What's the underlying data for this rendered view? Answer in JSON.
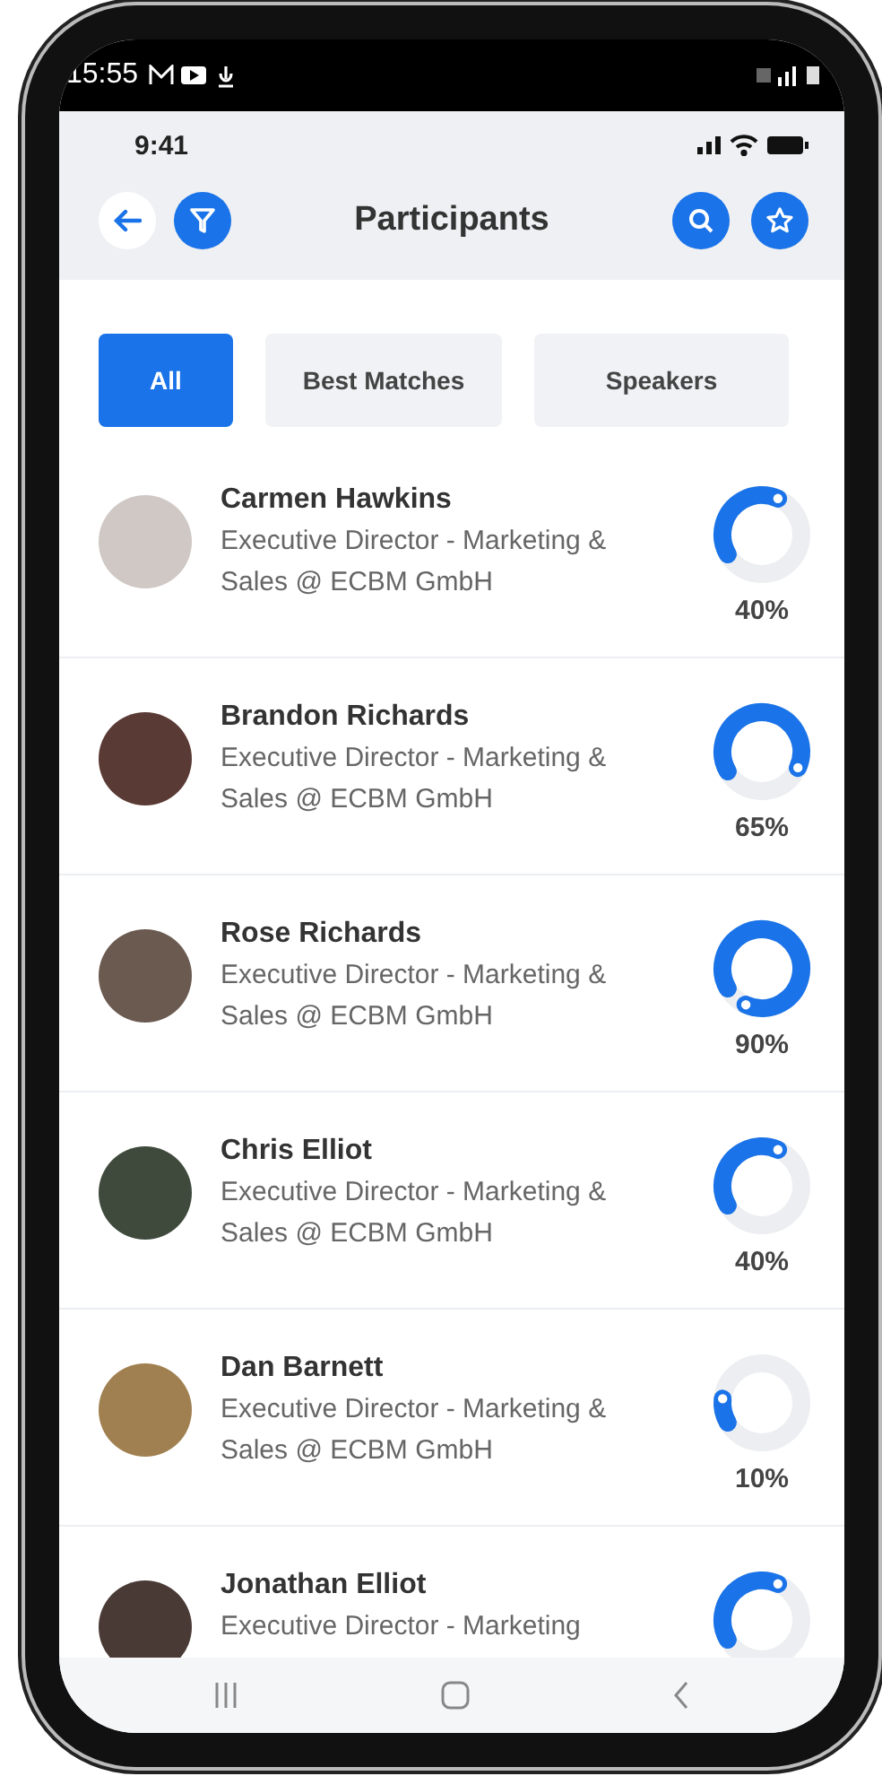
{
  "system_status_bar": {
    "time": "15:55"
  },
  "app_status_bar": {
    "time": "9:41"
  },
  "header": {
    "title": "Participants"
  },
  "tabs": [
    {
      "label": "All",
      "selected": true
    },
    {
      "label": "Best Matches",
      "selected": false
    },
    {
      "label": "Speakers",
      "selected": false
    }
  ],
  "participants": [
    {
      "name": "Carmen Hawkins",
      "role": "Executive Director - Marketing & Sales @ ECBM GmbH",
      "level": 0.4,
      "reading": "40%"
    },
    {
      "name": "Brandon Richards",
      "role": "Executive Director - Marketing & Sales @ ECBM GmbH",
      "level": 0.65,
      "reading": "65%"
    },
    {
      "name": "Rose Richards",
      "role": "Executive Director - Marketing & Sales @ ECBM GmbH",
      "level": 0.9,
      "reading": "90%"
    },
    {
      "name": "Chris Elliot",
      "role": "Executive Director - Marketing & Sales @ ECBM GmbH",
      "level": 0.4,
      "reading": "40%"
    },
    {
      "name": "Dan Barnett",
      "role": "Executive Director - Marketing & Sales @ ECBM GmbH",
      "level": 0.1,
      "reading": "10%"
    },
    {
      "name": "Jonathan Elliot",
      "role": "Executive Director - Marketing",
      "level": 0.4
    }
  ]
}
